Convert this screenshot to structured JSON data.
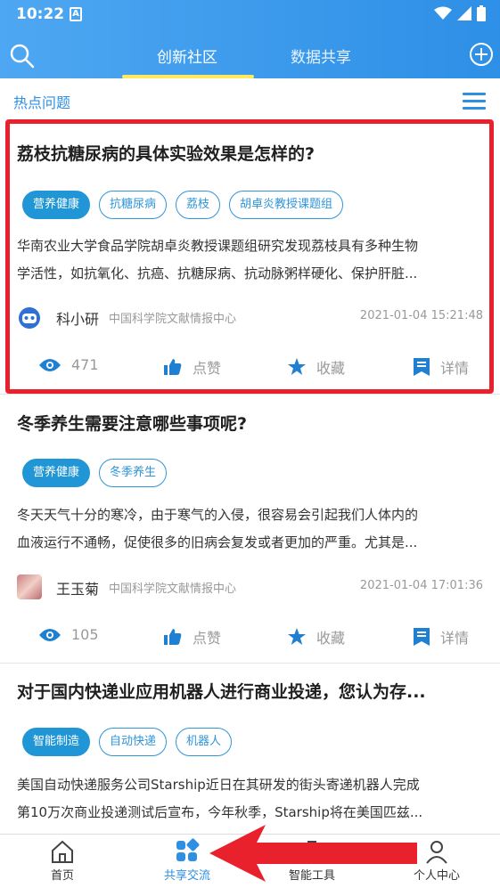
{
  "status_bar": {
    "time": "10:22",
    "a_icon": "A"
  },
  "header": {
    "tabs": [
      {
        "label": "创新社区",
        "active": true
      },
      {
        "label": "数据共享",
        "active": false
      }
    ]
  },
  "subheader": {
    "title": "热点问题"
  },
  "posts": [
    {
      "title": "荔枝抗糖尿病的具体实验效果是怎样的?",
      "tags": [
        "营养健康",
        "抗糖尿病",
        "荔枝",
        "胡卓炎教授课题组"
      ],
      "summary_line1": "华南农业大学食品学院胡卓炎教授课题组研究发现荔枝具有多种生物",
      "summary_line2": "学活性，如抗氧化、抗癌、抗糖尿病、抗动脉粥样硬化、保护肝脏...",
      "author": "科小研",
      "org": "中国科学院文献情报中心",
      "time": "2021-01-04 15:21:48",
      "views": "471",
      "like_label": "点赞",
      "fav_label": "收藏",
      "detail_label": "详情"
    },
    {
      "title": "冬季养生需要注意哪些事项呢?",
      "tags": [
        "营养健康",
        "冬季养生"
      ],
      "summary_line1": "冬天天气十分的寒冷，由于寒气的入侵，很容易会引起我们人体内的",
      "summary_line2": "血液运行不通畅，促使很多的旧病会复发或者更加的严重。尤其是...",
      "author": "王玉菊",
      "org": "中国科学院文献情报中心",
      "time": "2021-01-04 17:01:36",
      "views": "105",
      "like_label": "点赞",
      "fav_label": "收藏",
      "detail_label": "详情"
    },
    {
      "title": "对于国内快递业应用机器人进行商业投递，您认为存...",
      "tags": [
        "智能制造",
        "自动快递",
        "机器人"
      ],
      "summary_line1": "美国自动快递服务公司Starship近日在其研发的街头寄递机器人完成",
      "summary_line2": "第10万次商业投递测试后宣布，今年秋季，Starship将在美国匹兹..."
    }
  ],
  "bottom_nav": [
    {
      "label": "首页",
      "icon": "home-icon"
    },
    {
      "label": "共享交流",
      "icon": "share-grid-icon",
      "active": true
    },
    {
      "label": "智能工具",
      "icon": "tools-icon"
    },
    {
      "label": "个人中心",
      "icon": "person-icon"
    }
  ],
  "colors": {
    "accent": "#2f8fe3",
    "highlight": "#e8212c",
    "tab_underline": "#ffe95e"
  }
}
